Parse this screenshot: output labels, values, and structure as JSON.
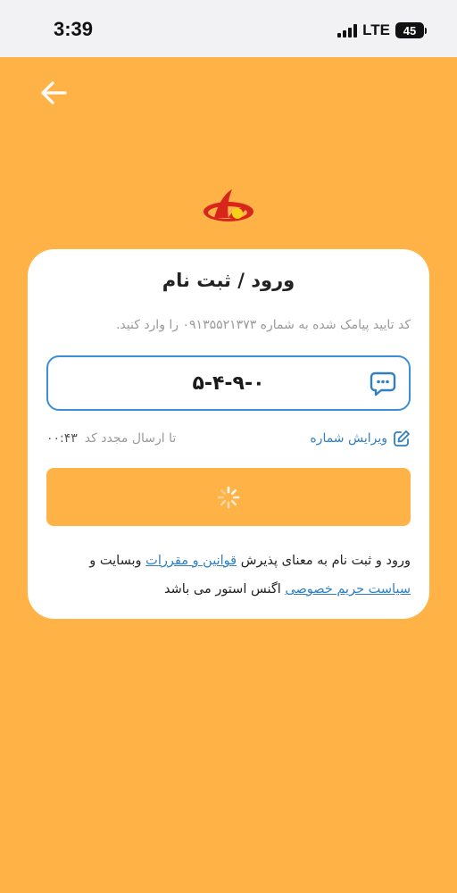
{
  "status_bar": {
    "time": "3:39",
    "network": "LTE",
    "battery": "45"
  },
  "header": {
    "back_icon": "arrow-left-icon",
    "logo": "brand-logo"
  },
  "card": {
    "title": "ورود / ثبت نام",
    "hint": "کد تایید پیامک شده به شماره ۰۹۱۳۵۵۲۱۳۷۳ را وارد کنید.",
    "code_value": "۵-۴-۹-۰",
    "code_icon": "message-bubble-icon",
    "resend_label": "تا ارسال مجدد کد",
    "resend_timer": "۰۰:۴۳",
    "edit_label": "ویرایش شماره",
    "edit_icon": "edit-pencil-icon",
    "submit_icon": "spinner-icon",
    "terms": {
      "part1": "ورود و ثبت نام به معنای پذیرش",
      "rules_link": "قوانین و مقررات",
      "part2": "وبسایت و",
      "privacy_link": "سیاست حریم خصوصی",
      "part3": "اگنس استور می باشد"
    }
  },
  "colors": {
    "background": "#ffb347",
    "accent_blue": "#2f7fc1",
    "card": "#ffffff"
  }
}
